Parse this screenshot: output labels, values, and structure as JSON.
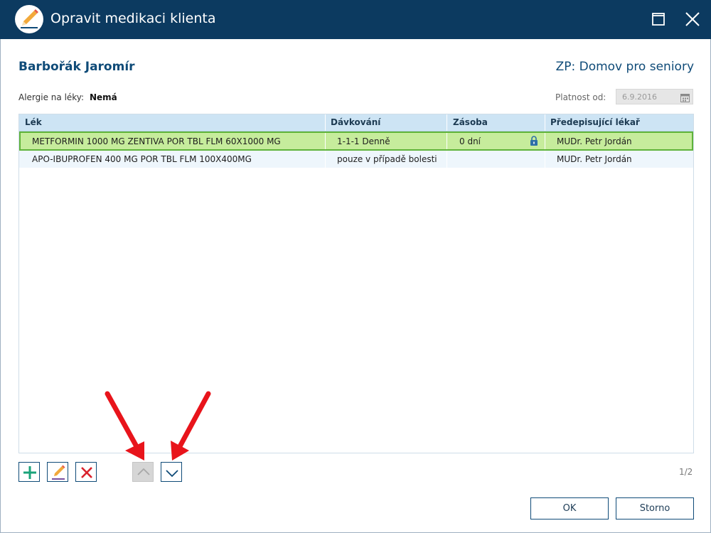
{
  "window": {
    "title": "Opravit medikaci klienta",
    "maximize_icon": "maximize-icon",
    "close_icon": "close-icon",
    "app_icon": "pencil-icon"
  },
  "client": {
    "name": "Barbořák Jaromír",
    "zp": "ZP: Domov pro seniory",
    "allergy_label": "Alergie na léky:",
    "allergy_value": "Nemá",
    "validity_label": "Platnost od:",
    "validity_date": "6.9.2016"
  },
  "table": {
    "headers": [
      "Lék",
      "Dávkování",
      "Zásoba",
      "Předepisující lékař"
    ],
    "rows": [
      {
        "lek": "METFORMIN 1000 MG ZENTIVA POR TBL FLM 60X1000 MG",
        "davkovani": "1-1-1 Denně",
        "zasoba": "0 dní",
        "lekar": "MUDr. Petr Jordán",
        "locked": true,
        "selected": true
      },
      {
        "lek": "APO-IBUPROFEN 400 MG POR TBL FLM 100X400MG",
        "davkovani": "pouze v případě bolesti",
        "zasoba": "",
        "lekar": "MUDr. Petr Jordán",
        "locked": false,
        "selected": false
      }
    ]
  },
  "toolbar": {
    "page_indicator": "1/2",
    "buttons": [
      "add-icon",
      "edit-icon",
      "delete-icon",
      "move-up-icon",
      "move-down-icon"
    ]
  },
  "footer": {
    "ok_label": "OK",
    "cancel_label": "Storno"
  },
  "colors": {
    "titlebar": "#0c3a60",
    "accent": "#0f4b78",
    "selected_row": "#c6ec9c",
    "selected_border": "#5fb33a",
    "header_bg": "#cde4f4",
    "annotation_arrow": "#e8141b"
  }
}
